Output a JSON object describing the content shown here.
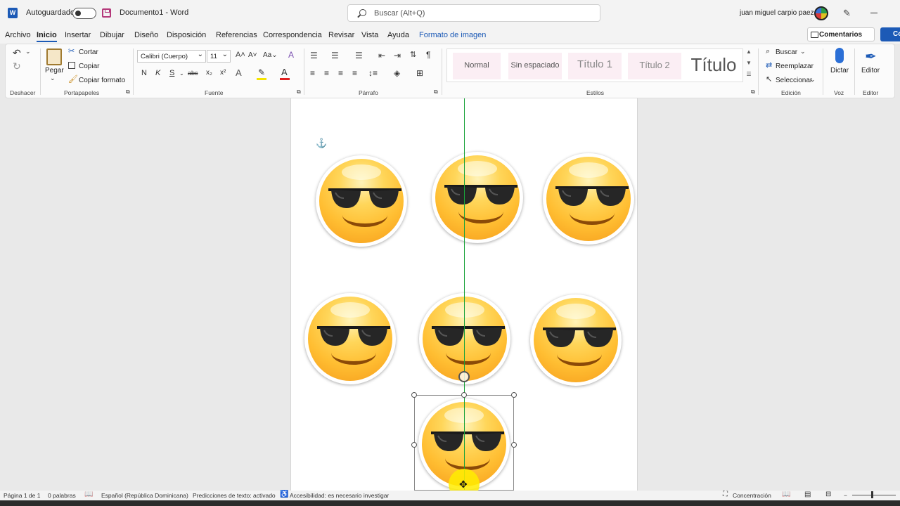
{
  "titlebar": {
    "autosave_label": "Autoguardado",
    "doc_title": "Documento1  -  Word",
    "search_placeholder": "Buscar (Alt+Q)",
    "user_name": "juan miguel carpio paez"
  },
  "tabs": [
    "Archivo",
    "Inicio",
    "Insertar",
    "Dibujar",
    "Diseño",
    "Disposición",
    "Referencias",
    "Correspondencia",
    "Revisar",
    "Vista",
    "Ayuda",
    "Formato de imagen"
  ],
  "comments_label": "Comentarios",
  "share_label": "Co",
  "ribbon": {
    "undo_group": "Deshacer",
    "clipboard": {
      "paste": "Pegar",
      "cut": "Cortar",
      "copy": "Copiar",
      "format_painter": "Copiar formato",
      "group": "Portapapeles"
    },
    "font": {
      "name": "Calibri (Cuerpo)",
      "size": "11",
      "bold": "N",
      "italic": "K",
      "underline": "S",
      "strike": "abc",
      "sub": "x₂",
      "sup": "x²",
      "group": "Fuente"
    },
    "paragraph": {
      "group": "Párrafo",
      "pilcrow": "¶"
    },
    "styles": {
      "normal": "Normal",
      "no_spacing": "Sin espaciado",
      "title1": "Título 1",
      "title2": "Título 2",
      "title": "Título",
      "group": "Estilos"
    },
    "editing": {
      "find": "Buscar",
      "replace": "Reemplazar",
      "select": "Seleccionar",
      "group": "Edición"
    },
    "voice": {
      "dictate": "Dictar",
      "group": "Voz"
    },
    "editor": {
      "label": "Editor",
      "group": "Editor"
    }
  },
  "status": {
    "page": "Página 1 de 1",
    "words": "0 palabras",
    "language": "Español (República Dominicana)",
    "predictions": "Predicciones de texto: activado",
    "accessibility": "Accesibilidad: es necesario investigar",
    "focus": "Concentración"
  },
  "colors": {
    "accent": "#1c5ab6",
    "guide": "#1aa33a",
    "font_color_bar": "#e02020",
    "highlight_bar": "#f5e400"
  }
}
